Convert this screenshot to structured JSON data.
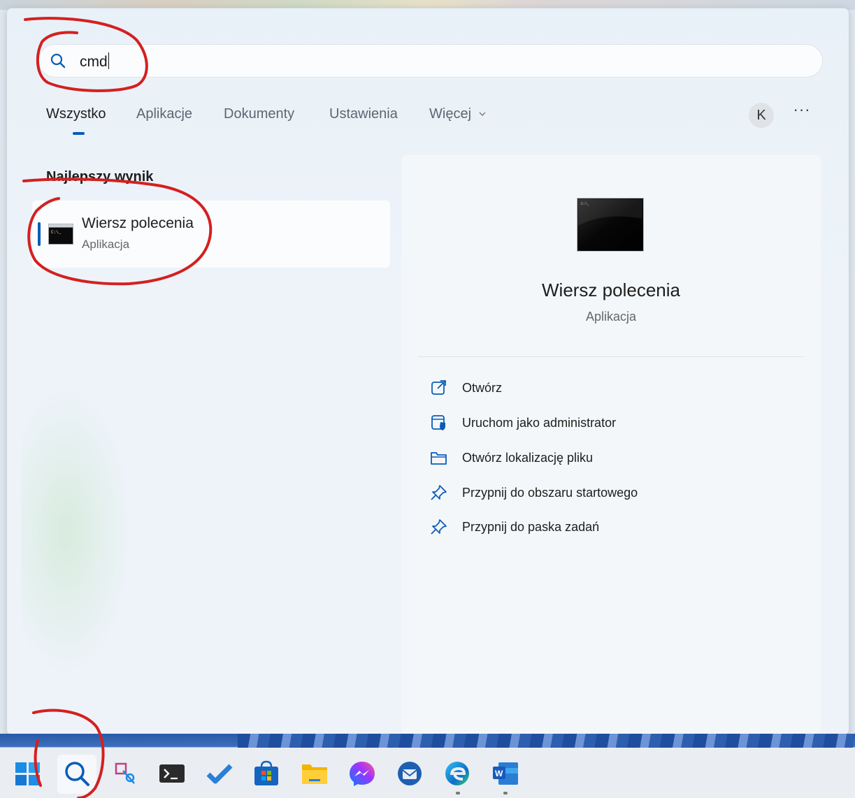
{
  "search": {
    "query": "cmd"
  },
  "tabs": [
    {
      "label": "Wszystko",
      "active": true
    },
    {
      "label": "Aplikacje",
      "active": false
    },
    {
      "label": "Dokumenty",
      "active": false
    },
    {
      "label": "Ustawienia",
      "active": false
    },
    {
      "label": "Więcej",
      "active": false
    }
  ],
  "account": {
    "initial": "K"
  },
  "more_label": "···",
  "best_match": {
    "section_title": "Najlepszy wynik",
    "name": "Wiersz polecenia",
    "type": "Aplikacja"
  },
  "details": {
    "name": "Wiersz polecenia",
    "type": "Aplikacja",
    "actions": [
      {
        "label": "Otwórz",
        "icon": "open-external-icon"
      },
      {
        "label": "Uruchom jako administrator",
        "icon": "admin-shield-icon"
      },
      {
        "label": "Otwórz lokalizację pliku",
        "icon": "folder-icon"
      },
      {
        "label": "Przypnij do obszaru startowego",
        "icon": "pin-icon"
      },
      {
        "label": "Przypnij do paska zadań",
        "icon": "pin-icon"
      }
    ]
  },
  "taskbar": {
    "icons": [
      "windows-start-icon",
      "search-icon",
      "snipping-tool-icon",
      "terminal-icon",
      "todo-icon",
      "store-icon",
      "file-explorer-icon",
      "messenger-icon",
      "thunderbird-icon",
      "edge-icon",
      "word-icon"
    ]
  },
  "colors": {
    "accent": "#0a5cb8",
    "annotation": "#d42020"
  }
}
